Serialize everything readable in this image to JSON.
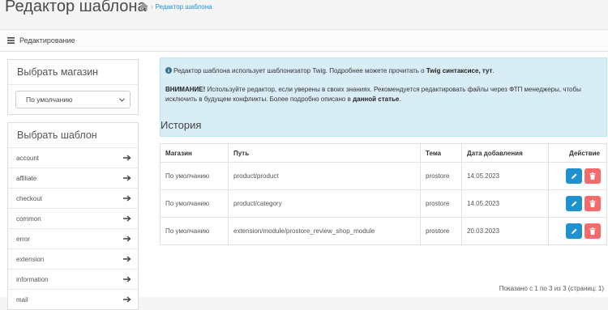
{
  "header": {
    "title": "Редактор шаблона",
    "breadcrumb_current": "Редактор шаблона",
    "breadcrumb_sep": "›"
  },
  "panel": {
    "heading": "Редактирование"
  },
  "store": {
    "title": "Выбрать магазин",
    "selected": "По умолчанию"
  },
  "templates": {
    "title": "Выбрать шаблон",
    "items": [
      "account",
      "affiliate",
      "checkout",
      "common",
      "error",
      "extension",
      "information",
      "mail"
    ]
  },
  "alert": {
    "line1_prefix": "Редактор шаблона использует шаблонизатор Twig. Подробнее можете прочитать о ",
    "line1_bold": "Twig синтаксисе, тут",
    "line1_suffix": ".",
    "line2_bold": "ВНИМАНИЕ!",
    "line2_text": " Используйте редактор, если уверены в своих знаниях. Рекомендуется редактировать файлы через ФТП менеджеры, чтобы исключить в будущем конфликты. Более подробно описано в ",
    "line2_link": "данной статье",
    "line2_end": "."
  },
  "history": {
    "title": "История",
    "columns": [
      "Магазин",
      "Путь",
      "Тема",
      "Дата добавления",
      "Действие"
    ],
    "rows": [
      {
        "store": "По умолчанию",
        "path": "product/product",
        "theme": "prostore",
        "date": "14.05.2023"
      },
      {
        "store": "По умолчанию",
        "path": "product/category",
        "theme": "prostore",
        "date": "14.05.2023"
      },
      {
        "store": "По умолчанию",
        "path": "extension/module/prostore_review_shop_module",
        "theme": "prostore",
        "date": "20.03.2023"
      }
    ],
    "pagination": "Показано с 1 по 3 из 3 (страниц: 1)"
  },
  "colors": {
    "edit_button": "#1e91cf",
    "delete_button": "#f56b6b",
    "alert_bg": "#d9edf7",
    "link": "#1e91cf"
  },
  "icons": {
    "home": "home-icon",
    "list": "list-icon",
    "info": "info-circle-icon",
    "arrow": "arrow-right-icon",
    "edit": "pencil-icon",
    "delete": "trash-icon"
  }
}
